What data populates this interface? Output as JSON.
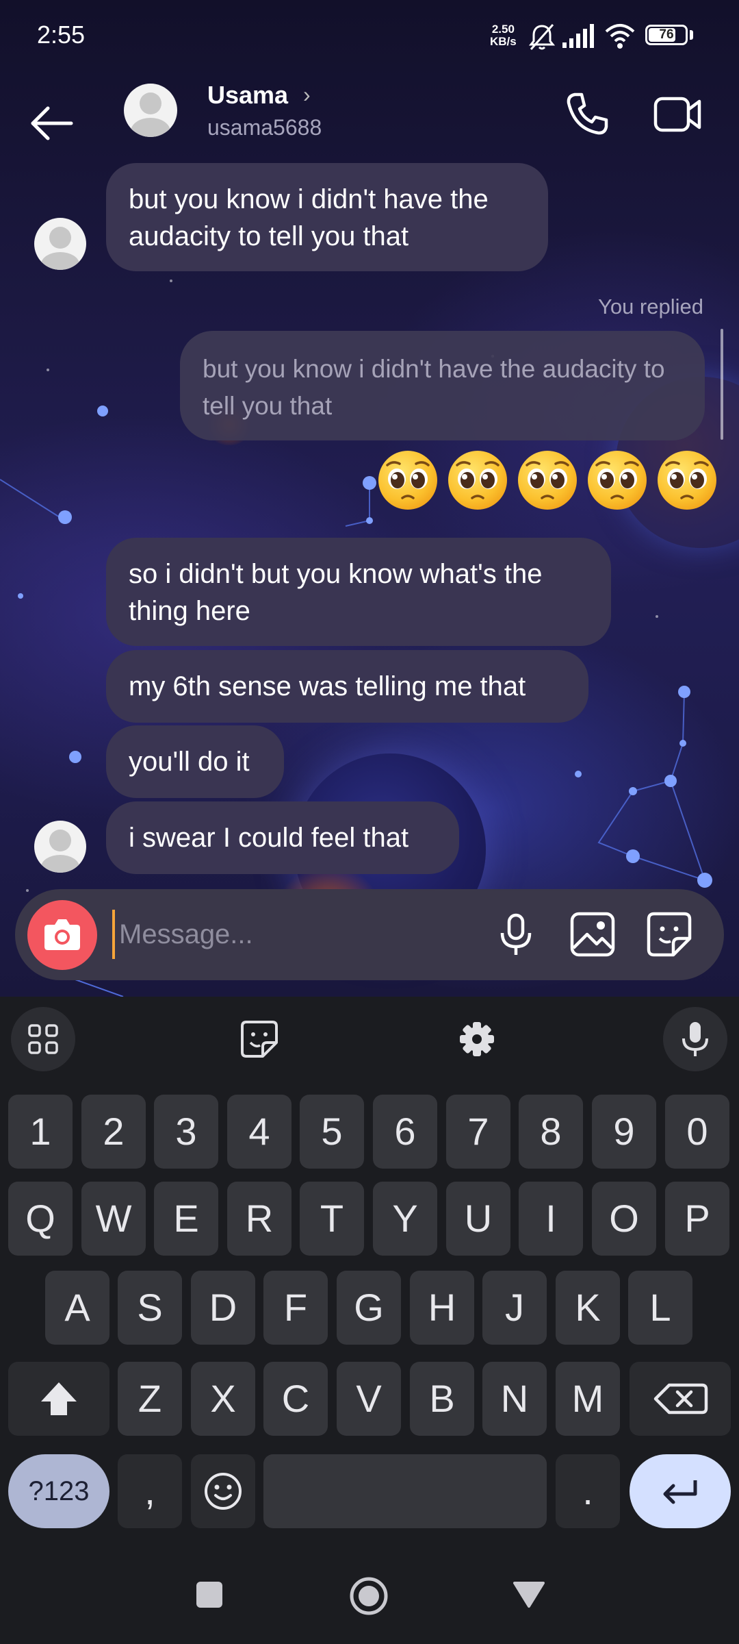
{
  "status_bar": {
    "time": "2:55",
    "speed_value": "2.50",
    "speed_unit": "KB/s",
    "battery": "76",
    "battery_level_percent": 76,
    "icons": [
      "mute-bell-icon",
      "signal-icon",
      "wifi-icon",
      "battery-icon"
    ]
  },
  "header": {
    "contact_name": "Usama",
    "chevron": "›",
    "username": "usama5688",
    "icons": [
      "back-arrow-icon",
      "avatar",
      "phone-icon",
      "video-camera-icon"
    ]
  },
  "messages": [
    {
      "from": "them",
      "text": "but you know i didn't have the audacity to tell you that"
    },
    {
      "from": "me",
      "reply_label": "You replied",
      "quoted": "but you know i didn't have the audacity to tell you that",
      "text": "🥺🥺🥺🥺🥺"
    },
    {
      "from": "them",
      "text": "so i didn't but you know what's the thing here"
    },
    {
      "from": "them",
      "text": "my 6th sense was telling me that"
    },
    {
      "from": "them",
      "text": "you'll do it"
    },
    {
      "from": "them",
      "text": "i swear I could feel that"
    }
  ],
  "m1": {
    "line1": "but you know i didn't have the",
    "line2": "audacity to tell you that"
  },
  "reply": {
    "label": "You replied",
    "line1": "but you know i didn't have the audacity to",
    "line2": "tell you that"
  },
  "m3": {
    "line1": "so i didn't but you know what's the",
    "line2": "thing here"
  },
  "m4": {
    "text": "my 6th sense was telling me that"
  },
  "m5": {
    "text": "you'll do it"
  },
  "m6": {
    "text": "i swear I could feel that"
  },
  "composer": {
    "placeholder": "Message...",
    "icons": [
      "camera-icon",
      "microphone-icon",
      "gallery-icon",
      "sticker-icon"
    ]
  },
  "keyboard": {
    "toolbar": [
      "apps-grid-icon",
      "sticker-icon",
      "settings-gear-icon",
      "microphone-icon"
    ],
    "row_numbers": [
      "1",
      "2",
      "3",
      "4",
      "5",
      "6",
      "7",
      "8",
      "9",
      "0"
    ],
    "row1": [
      "Q",
      "W",
      "E",
      "R",
      "T",
      "Y",
      "U",
      "I",
      "O",
      "P"
    ],
    "row2": [
      "A",
      "S",
      "D",
      "F",
      "G",
      "H",
      "J",
      "K",
      "L"
    ],
    "row3": [
      "Z",
      "X",
      "C",
      "V",
      "B",
      "N",
      "M"
    ],
    "sym_label": "?123",
    "comma": ",",
    "period": ".",
    "special_icons": [
      "shift-icon",
      "backspace-icon",
      "emoji-icon",
      "enter-icon"
    ]
  },
  "nav": {
    "icons": [
      "recents-square-icon",
      "home-circle-icon",
      "back-triangle-icon"
    ]
  },
  "colors": {
    "bubble": "#3a3552",
    "camera_button": "#f3565f",
    "cursor": "#f6a53a",
    "enter_key": "#d4e0ff",
    "symbols_key": "#aeb6d3"
  }
}
